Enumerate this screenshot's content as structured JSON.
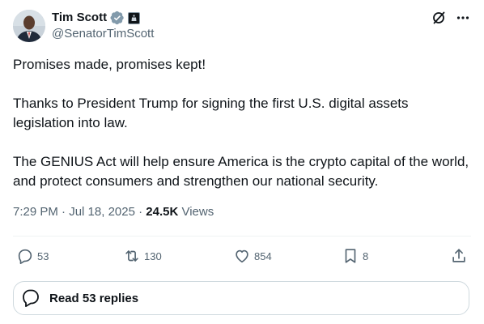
{
  "author": {
    "name": "Tim Scott",
    "handle": "@SenatorTimScott"
  },
  "tweet": {
    "paragraphs": [
      "Promises made, promises kept!",
      "Thanks to President Trump for signing the first U.S. digital assets legislation into law.",
      "The GENIUS Act will help ensure America is the crypto capital of the world, and protect consumers and strengthen our national security."
    ],
    "time": "7:29 PM",
    "separator": " · ",
    "date": "Jul 18, 2025",
    "views_count": "24.5K",
    "views_label": " Views"
  },
  "actions": {
    "replies": "53",
    "reposts": "130",
    "likes": "854",
    "bookmarks": "8"
  },
  "read_replies_label": "Read 53 replies",
  "colors": {
    "verified_badge": "#829aab",
    "muted_text": "#536471",
    "primary_text": "#0f1419"
  },
  "icons": [
    "verified-badge-icon",
    "affiliate-badge-icon",
    "grok-icon",
    "more-icon",
    "reply-icon",
    "repost-icon",
    "like-icon",
    "bookmark-icon",
    "share-icon",
    "read-replies-icon"
  ]
}
